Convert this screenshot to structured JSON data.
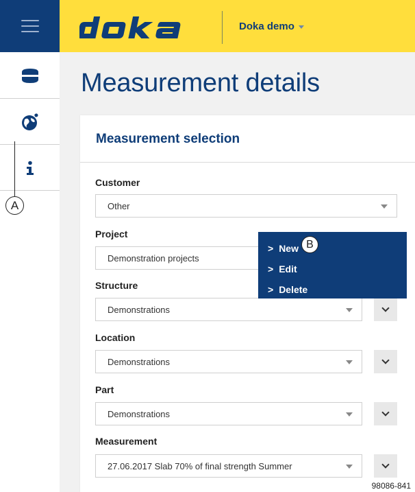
{
  "header": {
    "logo_text": "doka",
    "tenant": "Doka demo"
  },
  "sidebar": {
    "items": [
      {
        "icon": "sensor-icon"
      },
      {
        "icon": "globe-icon"
      },
      {
        "icon": "info-icon",
        "label": "i"
      }
    ]
  },
  "callouts": {
    "a": "A",
    "b": "B"
  },
  "page": {
    "title": "Measurement details"
  },
  "card": {
    "title": "Measurement selection",
    "fields": [
      {
        "label": "Customer",
        "value": "Other"
      },
      {
        "label": "Project",
        "value": "Demonstration projects"
      },
      {
        "label": "Structure",
        "value": "Demonstrations"
      },
      {
        "label": "Location",
        "value": "Demonstrations"
      },
      {
        "label": "Part",
        "value": "Demonstrations"
      },
      {
        "label": "Measurement",
        "value": "27.06.2017 Slab 70% of final strength Summer"
      }
    ]
  },
  "menu": {
    "items": [
      {
        "prefix": ">",
        "label": "New"
      },
      {
        "prefix": ">",
        "label": "Edit"
      },
      {
        "prefix": ">",
        "label": "Delete"
      }
    ]
  },
  "figure_ref": "98086-841",
  "colors": {
    "brand_blue": "#0f3d78",
    "brand_yellow": "#ffde3c"
  }
}
